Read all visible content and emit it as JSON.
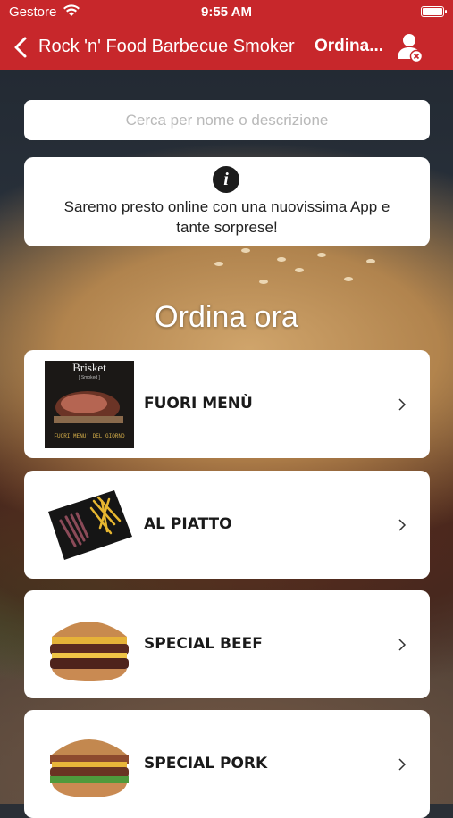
{
  "status": {
    "carrier": "Gestore",
    "time": "9:55 AM"
  },
  "nav": {
    "title": "Rock 'n' Food Barbecue Smoker",
    "order_label": "Ordina..."
  },
  "search": {
    "placeholder": "Cerca per nome o descrizione"
  },
  "notice": {
    "icon": "i",
    "message": "Saremo presto online con una nuovissima App e tante sorprese!"
  },
  "heading": "Ordina ora",
  "categories": [
    {
      "label": "FUORI MENÙ",
      "thumb_title": "Brisket",
      "thumb_sub": "[ Smoked ]",
      "thumb_footer": "FUORI MENU' DEL GIORNO"
    },
    {
      "label": "AL PIATTO"
    },
    {
      "label": "SPECIAL BEEF"
    },
    {
      "label": "SPECIAL PORK"
    }
  ],
  "colors": {
    "brand_red": "#c7272b"
  }
}
